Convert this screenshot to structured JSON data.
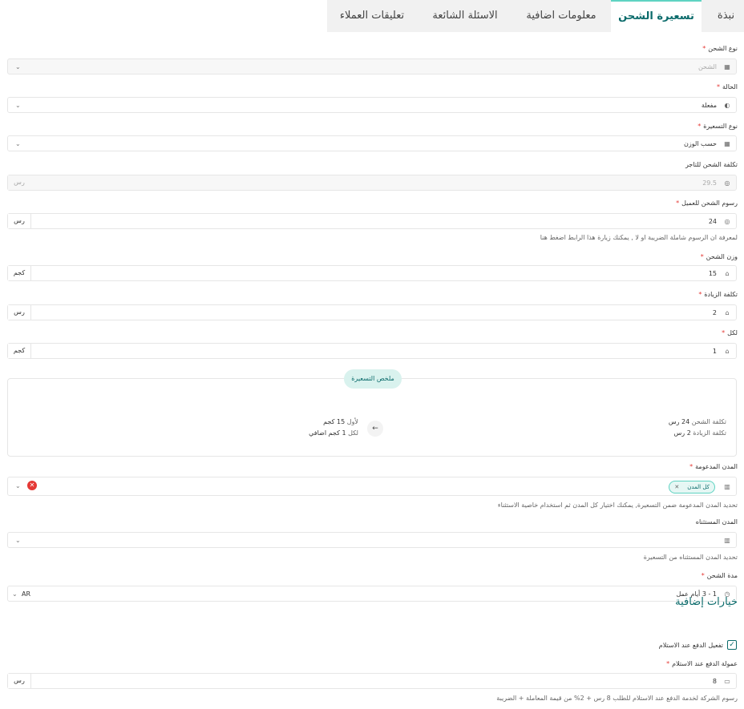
{
  "tabs": [
    {
      "label": "نبذة",
      "active": false
    },
    {
      "label": "تسعيرة الشحن",
      "active": true
    },
    {
      "label": "معلومات اضافية",
      "active": false
    },
    {
      "label": "الاسئلة الشائعة",
      "active": false
    },
    {
      "label": "تعليقات العملاء",
      "active": false
    }
  ],
  "form": {
    "shipping_type": {
      "label": "نوع الشحن",
      "required": "*",
      "value": "الشحن",
      "icon": "map-icon",
      "chevron": "⌄"
    },
    "status": {
      "label": "الحالة",
      "required": "*",
      "value": "مفعلة",
      "icon": "toggle-icon",
      "chevron": "⌄"
    },
    "pricing_type": {
      "label": "نوع التسعيرة",
      "required": "*",
      "value": "حسب الوزن",
      "icon": "map-icon",
      "chevron": "⌄"
    },
    "merchant_cost": {
      "label": "تكلفة الشحن للتاجر",
      "value": "29.5",
      "unit": "رس",
      "icon": "coin-icon"
    },
    "customer_fee": {
      "label": "رسوم الشحن للعميل",
      "required": "*",
      "value": "24",
      "unit": "رس",
      "icon": "coin-icon",
      "hint": "لمعرفة ان الرسوم شاملة الضريبة او لا , يمكنك زيارة هذا الرابط اضغط هنا"
    },
    "shipping_weight": {
      "label": "وزن الشحن",
      "required": "*",
      "value": "15",
      "unit": "كجم",
      "icon": "weight-icon"
    },
    "increase_cost": {
      "label": "تكلفة الزيادة",
      "required": "*",
      "value": "2",
      "unit": "رس",
      "icon": "weight-icon"
    },
    "per": {
      "label": "لكل",
      "required": "*",
      "value": "1",
      "unit": "كجم",
      "icon": "weight-icon"
    }
  },
  "summary": {
    "pill": "ملخص التسعيرة",
    "right_line1_label": "تكلفة الشحن",
    "right_line1_value": "24 رس",
    "right_line2_label": "تكلفة الزيادة",
    "right_line2_value": "2 رس",
    "left_line1_label": "لأول",
    "left_line1_value": "15 كجم",
    "left_line2_label": "لكل",
    "left_line2_value": "1 كجم اضافي",
    "arrow": "←"
  },
  "cities": {
    "label": "المدن المدعومة",
    "required": "*",
    "chip": "كل المدن",
    "chip_x": "✕",
    "clear": "✕",
    "chevron": "⌄",
    "hint": "تحديد المدن المدعومة ضمن التسعيرة, يمكنك اختيار كل المدن ثم استخدام خاصية الاستثناء"
  },
  "excluded": {
    "label": "المدن المستثناه",
    "chevron": "⌄",
    "hint": "تحديد المدن المستثناه من التسعيرة"
  },
  "duration": {
    "label": "مدة الشحن",
    "required": "*",
    "value": "1 - 3 أيام عمل",
    "lang": "AR",
    "chevron": "⌄"
  },
  "extra": {
    "title": "خيارات إضافية",
    "cod_checkbox_label": "تفعيل الدفع عند الاستلام",
    "check_mark": "✓",
    "cod_fee": {
      "label": "عمولة الدفع عند الاستلام",
      "required": "*",
      "value": "8",
      "unit": "رس",
      "hint": "رسوم الشركة لخدمة الدفع عند الاستلام للطلب 8 رس + 2% من قيمة المعاملة + الضريبة"
    }
  },
  "colors": {
    "accent": "#0b6b6b",
    "accent_light": "#5fd3c2",
    "required": "#e53935"
  }
}
